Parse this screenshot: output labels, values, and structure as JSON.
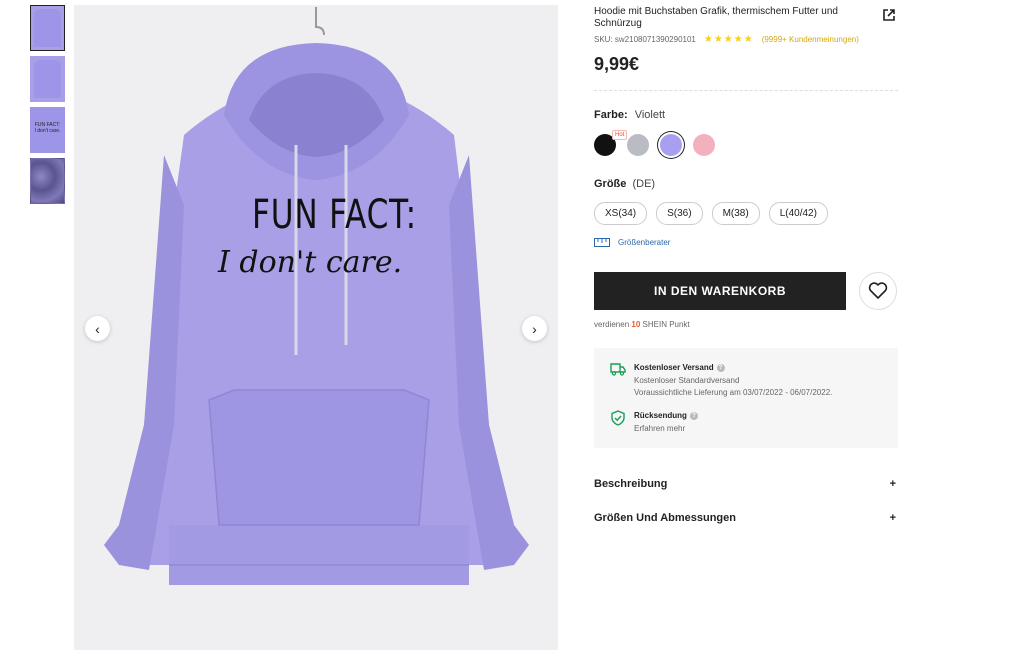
{
  "product": {
    "title": "Hoodie mit Buchstaben Grafik, thermischem Futter und Schnürzug",
    "sku": "SKU: sw2108071390290101",
    "rating_stars": "★★★★★",
    "reviews": "(9999+ Kundenmeinungen)",
    "price": "9,99€",
    "print_line1": "FUN FACT:",
    "print_line2": "I don't care."
  },
  "gallery": {
    "thumb_line1": "FUN FACT:",
    "thumb_line2": "I don't care.",
    "prev_icon": "‹",
    "next_icon": "›"
  },
  "color": {
    "label": "Farbe:",
    "value": "Violett",
    "hot_badge": "Hot",
    "swatches": [
      "#111111",
      "#b9bcc2",
      "#a89ff0",
      "#f3b1bd"
    ]
  },
  "size": {
    "label": "Größe",
    "unit": "(DE)",
    "options": [
      "XS(34)",
      "S(36)",
      "M(38)",
      "L(40/42)"
    ],
    "guide": "Größenberater"
  },
  "cart": {
    "button": "IN DEN WARENKORB",
    "points_prefix": "verdienen",
    "points_num": "10",
    "points_suffix": "SHEIN Punkt"
  },
  "shipping": {
    "title": "Kostenloser Versand",
    "line1": "Kostenloser Standardversand",
    "line2": "Voraussichtliche Lieferung am 03/07/2022 - 06/07/2022.",
    "return_title": "Rücksendung",
    "return_link": "Erfahren mehr",
    "qmark": "?"
  },
  "accordion": {
    "description": "Beschreibung",
    "sizes": "Größen Und Abmessungen",
    "plus": "+"
  },
  "colors": {
    "hoodie": "#a89fe6",
    "accent_green": "#1a9e56",
    "link_blue": "#2d68a8",
    "star_yellow": "#facf19"
  }
}
